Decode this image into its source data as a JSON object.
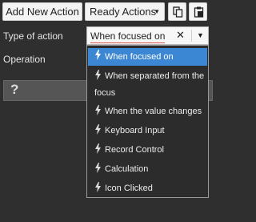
{
  "toolbar": {
    "add_label": "Add New Action",
    "ready_label": "Ready Actions",
    "ready_caret": "▼",
    "copy_icon": "copy-icon",
    "paste_icon": "paste-icon"
  },
  "form": {
    "type_label": "Type of action",
    "operation_label": "Operation",
    "select_value": "When focused on",
    "clear_glyph": "✕",
    "open_glyph": "▼"
  },
  "panel": {
    "glyph": "?"
  },
  "dropdown": {
    "items": [
      {
        "label": "When focused on",
        "selected": true
      },
      {
        "label": "When separated from the focus",
        "selected": false
      },
      {
        "label": "When the value changes",
        "selected": false
      },
      {
        "label": "Keyboard Input",
        "selected": false
      },
      {
        "label": "Record Control",
        "selected": false
      },
      {
        "label": "Calculation",
        "selected": false
      },
      {
        "label": "Icon Clicked",
        "selected": false
      }
    ]
  },
  "colors": {
    "background": "#2f2f2f",
    "selected": "#3b87d4",
    "underline": "#d9534f"
  }
}
